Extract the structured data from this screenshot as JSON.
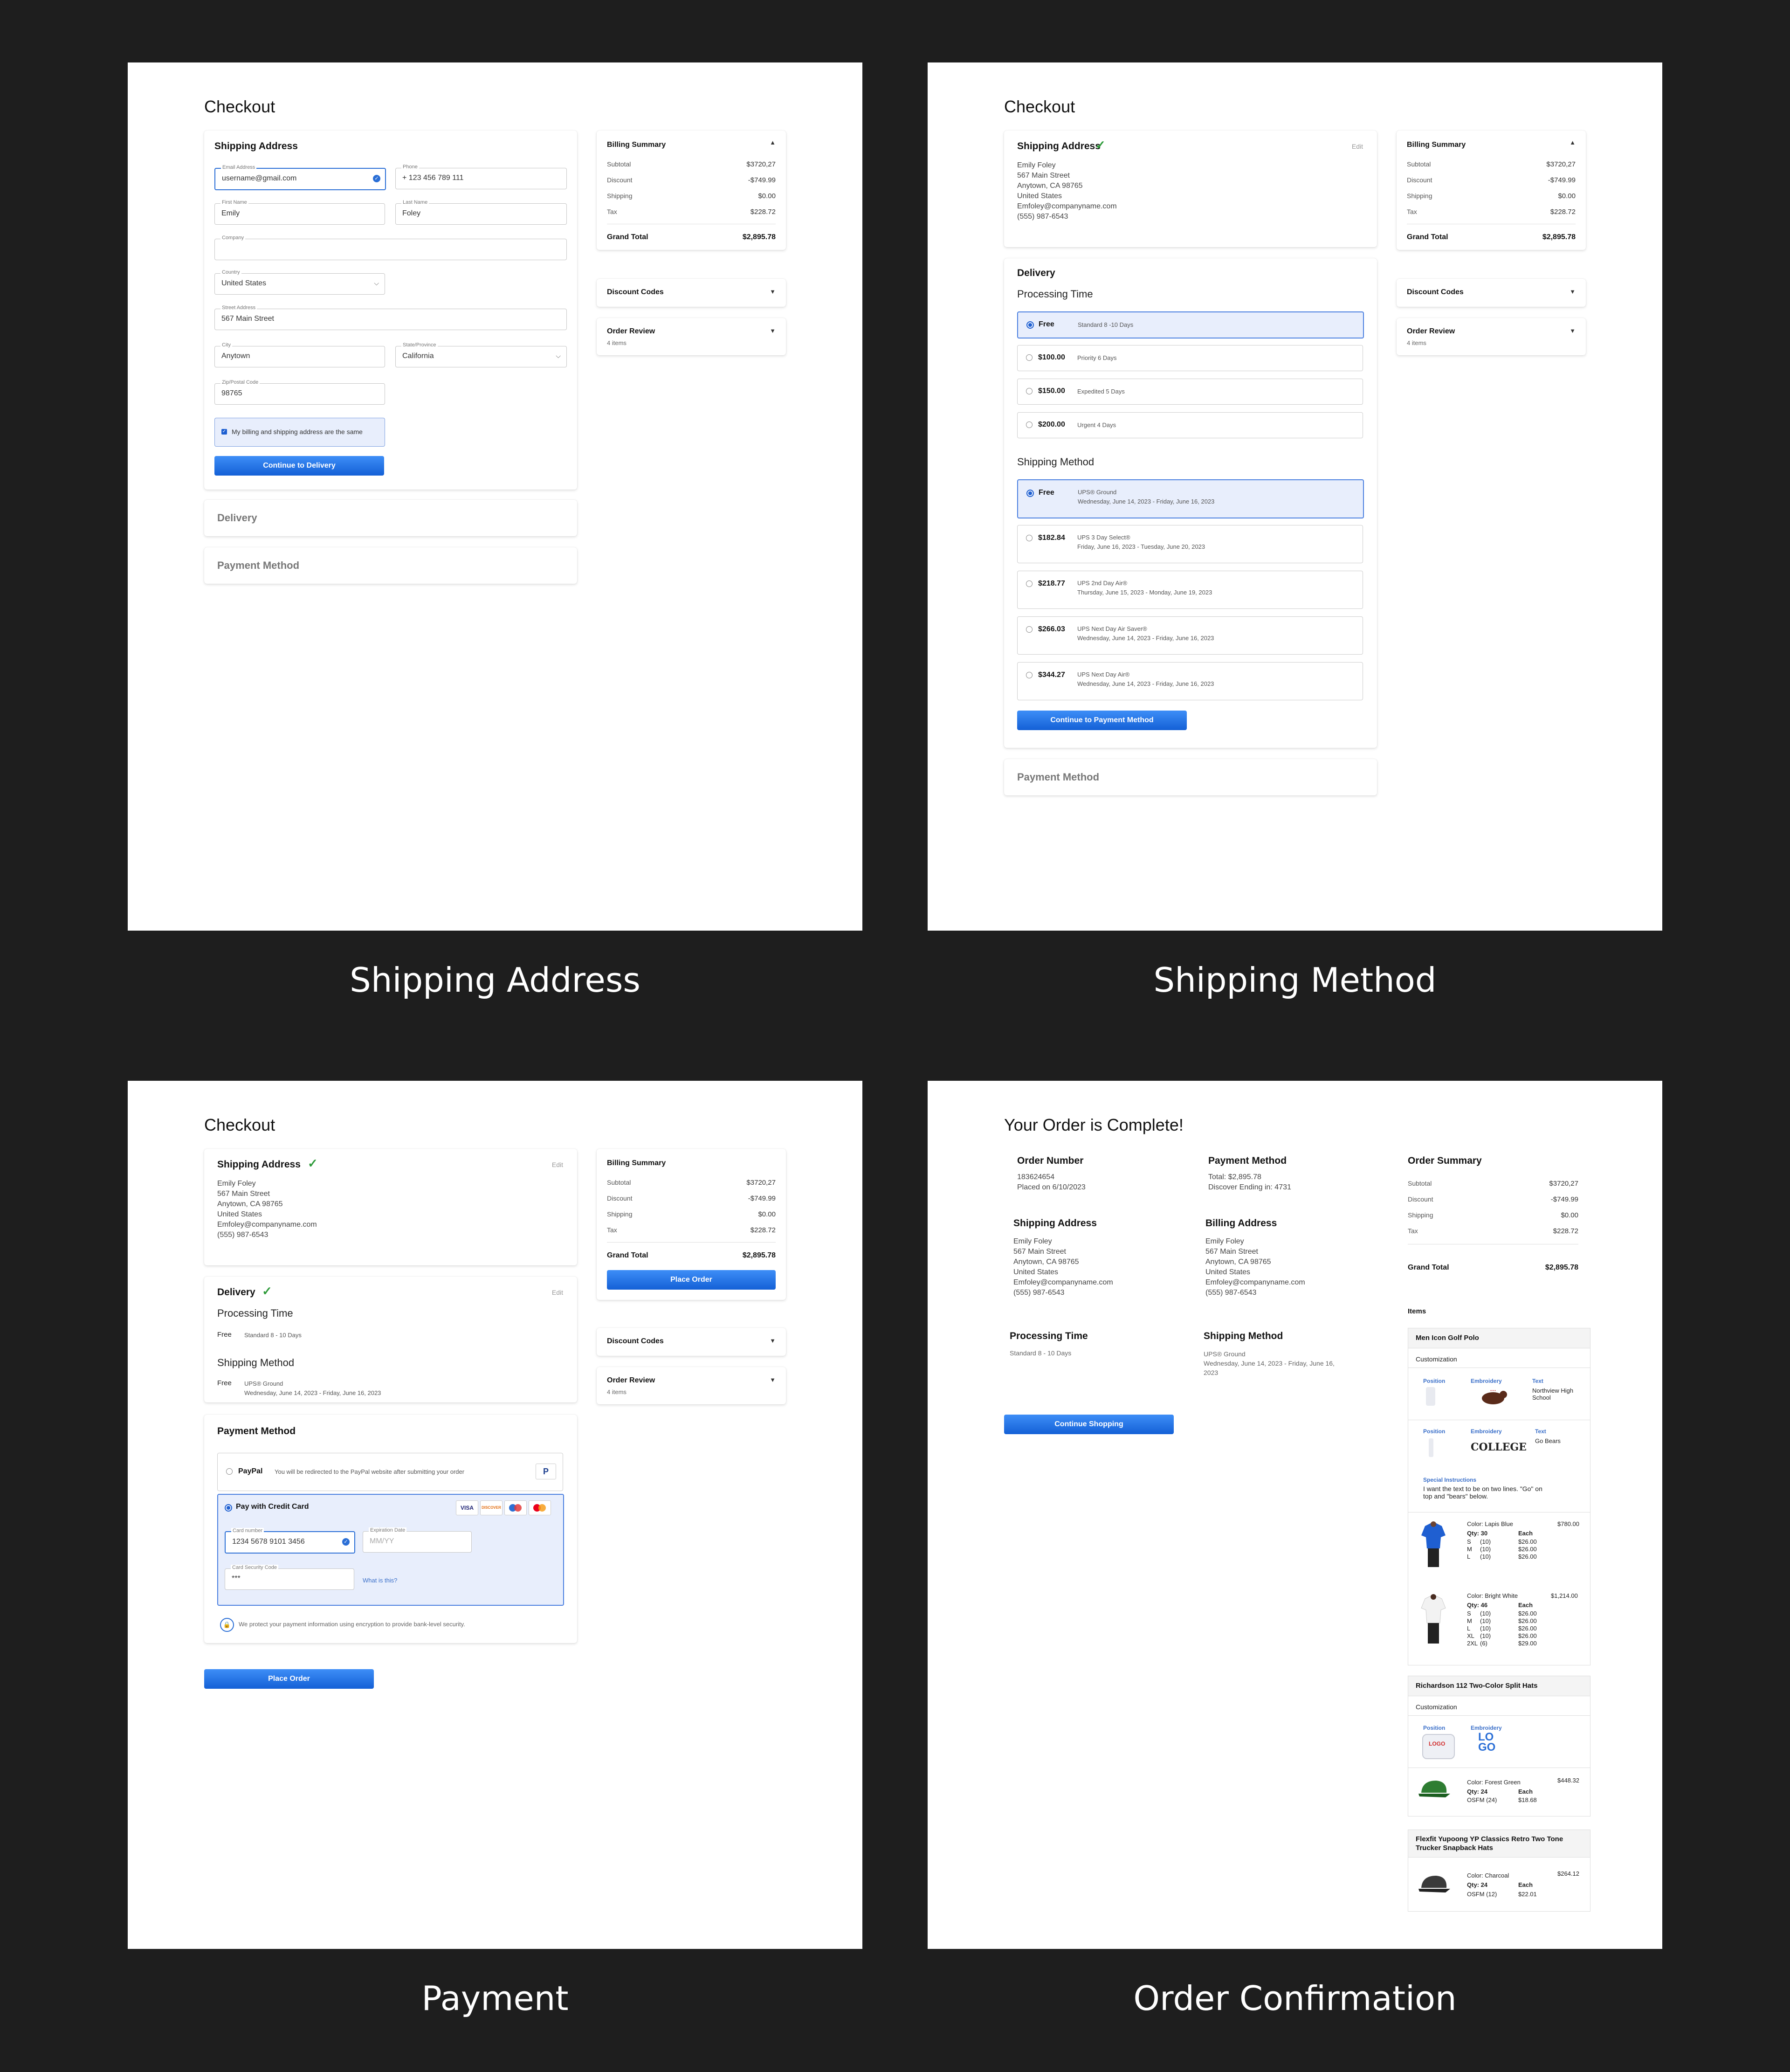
{
  "captions": {
    "shipping_address": "Shipping Address",
    "shipping_method": "Shipping Method",
    "payment": "Payment",
    "confirmation": "Order Confirmation"
  },
  "checkout_title": "Checkout",
  "billing": {
    "title": "Billing Summary",
    "rows": [
      {
        "label": "Subtotal",
        "value": "$3720,27"
      },
      {
        "label": "Discount",
        "value": "-$749.99"
      },
      {
        "label": "Shipping",
        "value": "$0.00"
      },
      {
        "label": "Tax",
        "value": "$228.72"
      }
    ],
    "total_label": "Grand Total",
    "total_value": "$2,895.78",
    "discount_codes": "Discount Codes",
    "order_review": "Order Review",
    "order_review_items": "4 items"
  },
  "address_form": {
    "heading": "Shipping Address",
    "email_label": "Email Address",
    "email_value": "username@gmail.com",
    "phone_label": "Phone",
    "phone_value": "+ 123 456 789 111",
    "first_label": "First Name",
    "first_value": "Emily",
    "last_label": "Last Name",
    "last_value": "Foley",
    "company_label": "Company",
    "country_label": "Country",
    "country_value": "United States",
    "street_label": "Street Address",
    "street_value": "567 Main Street",
    "city_label": "City",
    "city_value": "Anytown",
    "state_label": "State/Province",
    "state_value": "California",
    "zip_label": "Zip/Postal Code",
    "zip_value": "98765",
    "same_address": "My billing and shipping address are the same",
    "continue": "Continue to Delivery"
  },
  "steps": {
    "delivery": "Delivery",
    "payment_method": "Payment Method",
    "edit": "Edit"
  },
  "address": {
    "name": "Emily Foley",
    "street": "567 Main Street",
    "city": "Anytown, CA 98765",
    "country": "United States",
    "email": "Emfoley@companyname.com",
    "phone": "(555) 987-6543"
  },
  "delivery": {
    "processing_title": "Processing Time",
    "processing": [
      {
        "price": "Free",
        "desc": "Standard 8 -10 Days"
      },
      {
        "price": "$100.00",
        "desc": "Priority 6 Days"
      },
      {
        "price": "$150.00",
        "desc": "Expedited 5 Days"
      },
      {
        "price": "$200.00",
        "desc": "Urgent 4 Days"
      }
    ],
    "method_title": "Shipping Method",
    "methods": [
      {
        "price": "Free",
        "name": "UPS® Ground",
        "dates": "Wednesday, June 14, 2023 - Friday, June 16, 2023"
      },
      {
        "price": "$182.84",
        "name": "UPS 3 Day Select®",
        "dates": "Friday, June 16, 2023 - Tuesday, June 20, 2023"
      },
      {
        "price": "$218.77",
        "name": "UPS 2nd Day Air®",
        "dates": "Thursday, June 15, 2023 - Monday, June 19, 2023"
      },
      {
        "price": "$266.03",
        "name": "UPS Next Day Air Saver®",
        "dates": "Wednesday, June 14, 2023 - Friday, June 16, 2023"
      },
      {
        "price": "$344.27",
        "name": "UPS Next Day Air®",
        "dates": "Wednesday, June 14, 2023 - Friday, June 16, 2023"
      }
    ],
    "continue": "Continue to Payment Method",
    "summary_processing_desc": "Standard 8 - 10 Days"
  },
  "payment": {
    "paypal": "PayPal",
    "paypal_note": "You will be redirected to the PayPal website after submitting your order",
    "card": "Pay with Credit Card",
    "card_number_label": "Card number",
    "card_number": "1234 5678 9101 3456",
    "exp_label": "Expiration Date",
    "exp_placeholder": "MM/YY",
    "cvc_label": "Card Security Code",
    "cvc_value": "***",
    "what_is_this": "What is this?",
    "security_note": "We protect your payment information using encryption to provide bank-level security.",
    "place_order": "Place Order",
    "card_brands": [
      "VISA",
      "DISCOVER"
    ]
  },
  "confirmation": {
    "title": "Your Order is Complete!",
    "order_number_label": "Order Number",
    "order_number": "183624654",
    "placed_on": "Placed on 6/10/2023",
    "payment_method_label": "Payment Method",
    "payment_total": "Total: $2,895.78",
    "payment_card": "Discover Ending in: 4731",
    "shipping_address_label": "Shipping Address",
    "billing_address_label": "Billing Address",
    "processing_label": "Processing Time",
    "processing_value": "Standard 8 - 10 Days",
    "shipping_method_label": "Shipping Method",
    "shipping_method_name": "UPS® Ground",
    "shipping_method_dates": "Wednesday, June 14, 2023 - Friday, June 16, 2023",
    "continue": "Continue Shopping",
    "order_summary": "Order Summary",
    "items": "Items",
    "product1": {
      "name": "Men Icon Golf Polo",
      "customization": "Customization",
      "pos": "Position",
      "emb": "Embroidery",
      "text": "Text",
      "text1": "Northview High School",
      "text2": "Go Bears",
      "college": "COLLEGE",
      "special": "Special Instructions",
      "special_text": "I want the text to be on two lines. \"Go\" on top and \"bears\" below.",
      "v1_color": "Color: Lapis Blue",
      "v1_qty": "Qty: 30",
      "v1_price": "$780.00",
      "each": "Each",
      "v1_sizes": [
        [
          "S",
          "(10)",
          "$26.00"
        ],
        [
          "M",
          "(10)",
          "$26.00"
        ],
        [
          "L",
          "(10)",
          "$26.00"
        ]
      ],
      "v2_color": "Color: Bright White",
      "v2_qty": "Qty: 46",
      "v2_price": "$1,214.00",
      "v2_sizes": [
        [
          "S",
          "(10)",
          "$26.00"
        ],
        [
          "M",
          "(10)",
          "$26.00"
        ],
        [
          "L",
          "(10)",
          "$26.00"
        ],
        [
          "XL",
          "(10)",
          "$26.00"
        ],
        [
          "2XL",
          "(6)",
          "$29.00"
        ]
      ]
    },
    "product2": {
      "name": "Richardson 112 Two-Color Split Hats",
      "customization": "Customization",
      "pos": "Position",
      "emb": "Embroidery",
      "logo_a": "LOGO",
      "logo_b": "LO",
      "logo_c": "GO",
      "color": "Color: Forest Green",
      "qty": "Qty: 24",
      "each": "Each",
      "price": "$448.32",
      "size": "OSFM (24)",
      "size_price": "$18.68"
    },
    "product3": {
      "name": "Flexfit Yupoong YP Classics Retro Two Tone Trucker Snapback Hats",
      "color": "Color: Charcoal",
      "qty": "Qty: 24",
      "each": "Each",
      "price": "$264.12",
      "size": "OSFM (12)",
      "size_price": "$22.01"
    }
  }
}
